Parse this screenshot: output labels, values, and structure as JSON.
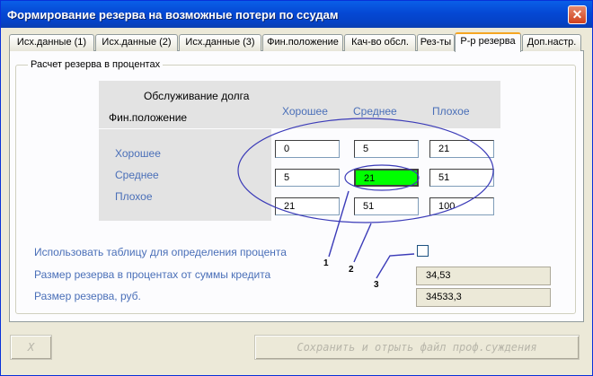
{
  "window": {
    "title": "Формирование резерва на возможные потери по ссудам"
  },
  "tabs": [
    {
      "label": "Исх.данные (1)",
      "active": false
    },
    {
      "label": "Исх.данные (2)",
      "active": false
    },
    {
      "label": "Исх.данные (3)",
      "active": false
    },
    {
      "label": "Фин.положение",
      "active": false
    },
    {
      "label": "Кач-во обсл.",
      "active": false
    },
    {
      "label": "Рез-ты",
      "active": false
    },
    {
      "label": "Р-р резерва",
      "active": true
    },
    {
      "label": "Доп.настр.",
      "active": false
    }
  ],
  "group": {
    "label": "Расчет резерва в процентах"
  },
  "matrix": {
    "header_main": "Обслуживание долга",
    "header_sub": "Фин.положение",
    "columns": [
      "Хорошее",
      "Среднее",
      "Плохое"
    ],
    "rows": [
      "Хорошее",
      "Среднее",
      "Плохое"
    ],
    "values": [
      [
        "0",
        "5",
        "21"
      ],
      [
        "5",
        "21",
        "51"
      ],
      [
        "21",
        "51",
        "100"
      ]
    ],
    "highlight": "#00ff00"
  },
  "annotations": [
    "1",
    "2",
    "3"
  ],
  "options": {
    "use_table_label": "Использовать таблицу для определения процента",
    "use_table_checked": false,
    "percent_label": "Размер резерва в процентах от суммы кредита",
    "percent_value": "34,53",
    "amount_label": "Размер резерва, руб.",
    "amount_value": "34533,3"
  },
  "buttons": {
    "close_label": "X",
    "save_label": "Сохранить и отрыть файл проф.суждения"
  },
  "colors": {
    "accent_blue": "#4a6fb8",
    "ellipse": "#3b3bb8"
  }
}
